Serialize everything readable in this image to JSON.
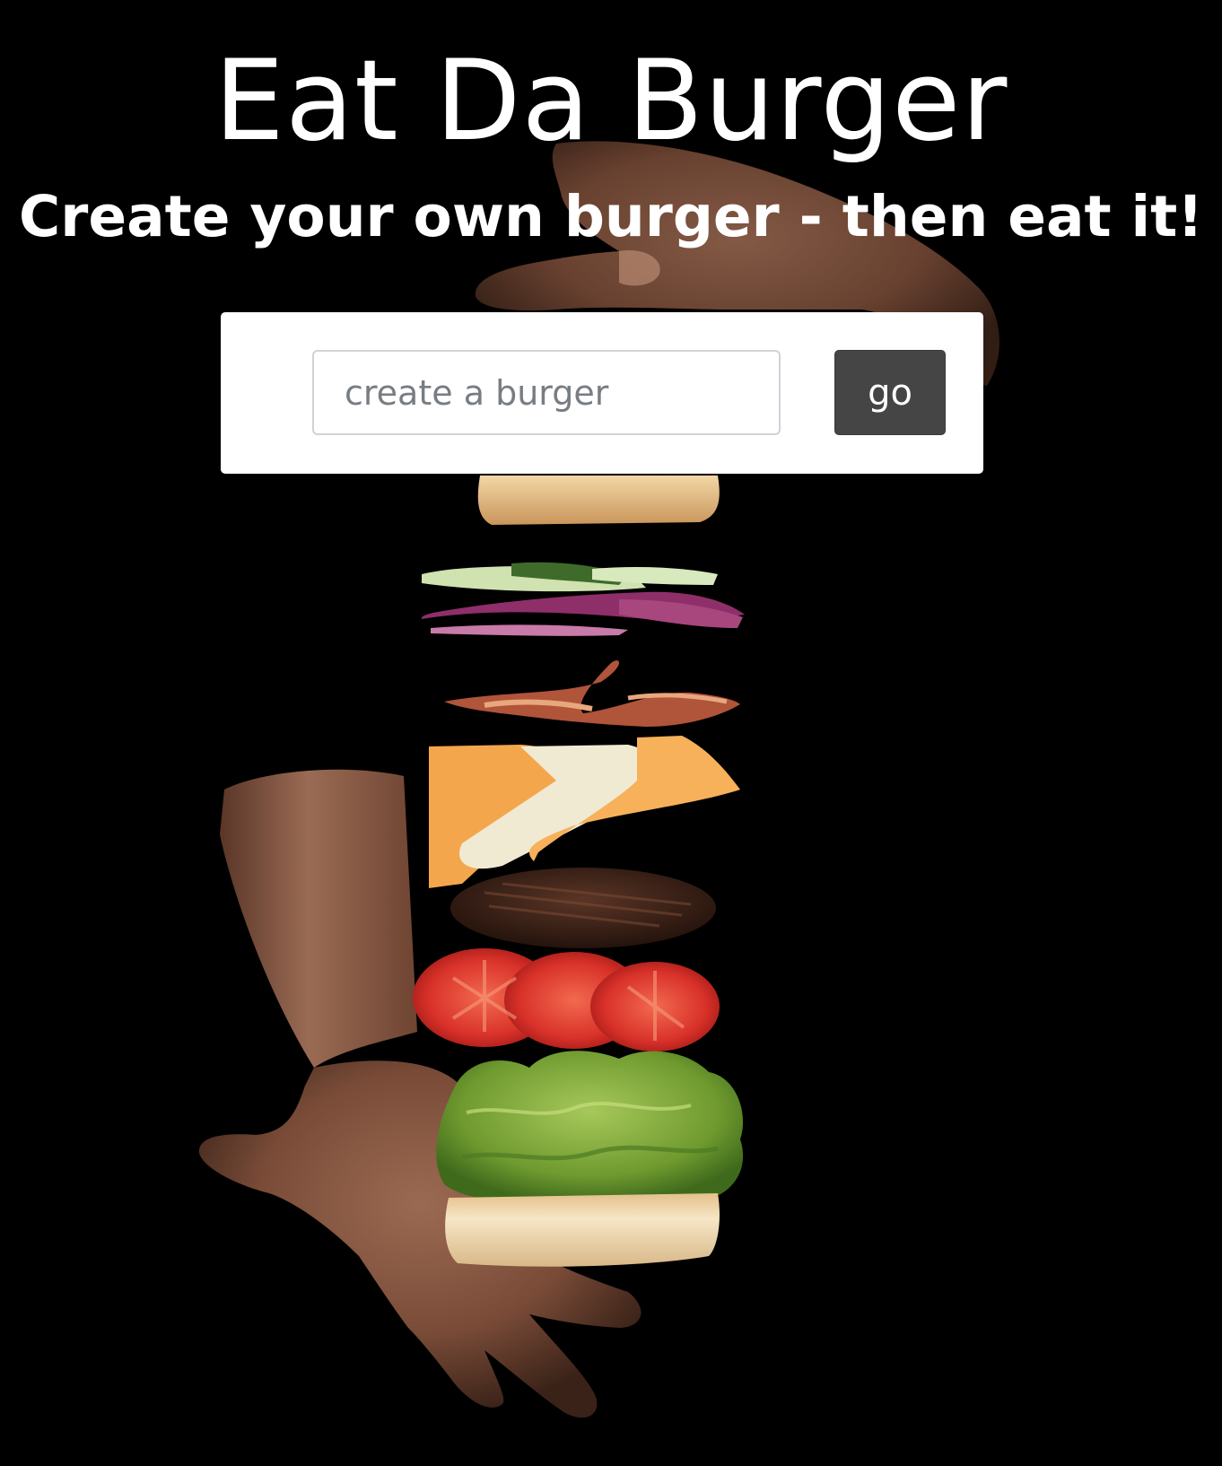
{
  "header": {
    "title": "Eat Da Burger",
    "subtitle": "Create your own burger - then eat it!"
  },
  "form": {
    "input_placeholder": "create a burger",
    "input_value": "",
    "submit_label": "go"
  },
  "hero_image": {
    "subject": "floating deconstructed burger between two hands",
    "colors": {
      "background": "#000000",
      "skin": "#8a5a44",
      "bun": "#e6bf86",
      "onion": "#8e2f6a",
      "cucumber": "#cfe2b0",
      "bacon": "#b0543a",
      "cheese_orange": "#f4a64c",
      "cheese_white": "#f1ead2",
      "patty": "#3b2218",
      "tomato": "#d9322a",
      "lettuce": "#7ca33a"
    }
  }
}
